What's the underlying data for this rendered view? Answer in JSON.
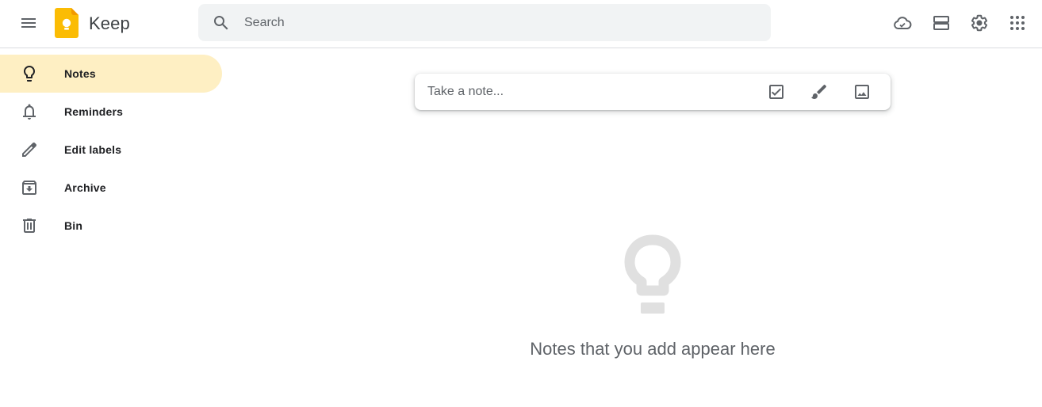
{
  "header": {
    "menu_icon": "hamburger-menu-icon",
    "logo_icon": "keep-logo-icon",
    "app_title": "Keep",
    "search": {
      "icon": "search-icon",
      "placeholder": "Search",
      "value": ""
    },
    "icons": [
      "cloud-sync-icon",
      "list-view-icon",
      "settings-gear-icon",
      "apps-grid-icon"
    ]
  },
  "sidebar": {
    "items": [
      {
        "label": "Notes",
        "icon": "lightbulb-icon",
        "active": true
      },
      {
        "label": "Reminders",
        "icon": "bell-icon",
        "active": false
      },
      {
        "label": "Edit labels",
        "icon": "pencil-icon",
        "active": false
      },
      {
        "label": "Archive",
        "icon": "archive-icon",
        "active": false
      },
      {
        "label": "Bin",
        "icon": "trash-icon",
        "active": false
      }
    ]
  },
  "take_note": {
    "placeholder": "Take a note...",
    "value": "",
    "tools": [
      "new-list-checkbox-icon",
      "new-drawing-brush-icon",
      "new-image-icon"
    ]
  },
  "empty_state": {
    "icon": "lightbulb-icon",
    "message": "Notes that you add appear here"
  },
  "colors": {
    "active_nav": "#feefc3",
    "search_bg": "#f1f3f4",
    "logo_yellow": "#fbbc04",
    "icon_grey": "#5f6368",
    "empty_icon": "#e0e0e0"
  }
}
